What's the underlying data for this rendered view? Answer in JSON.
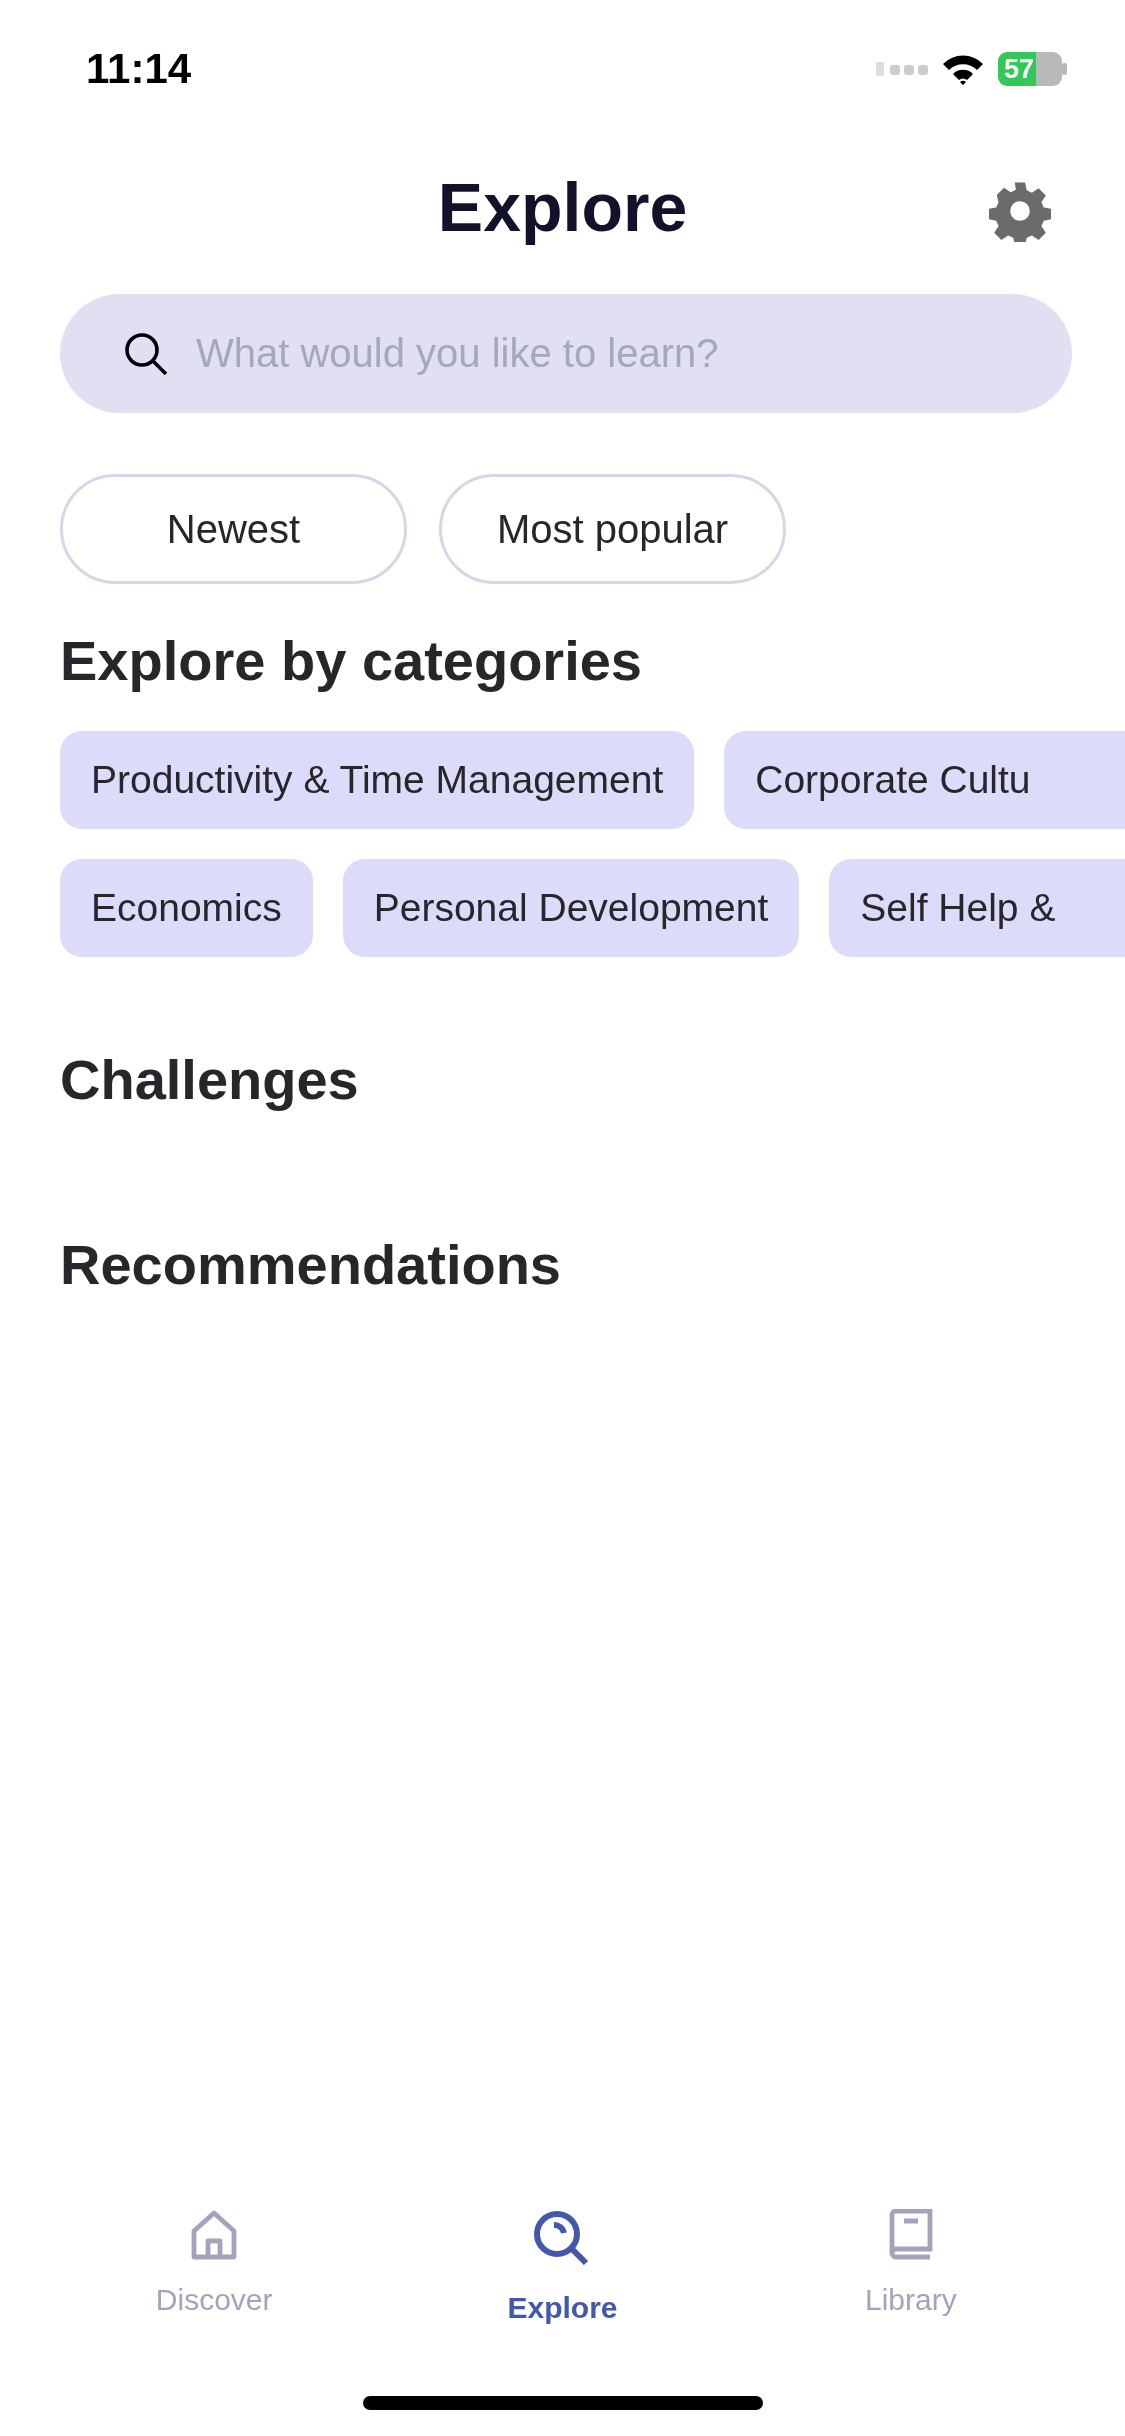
{
  "status_bar": {
    "time": "11:14",
    "battery": "57"
  },
  "header": {
    "title": "Explore"
  },
  "search": {
    "placeholder": "What would you like to learn?"
  },
  "filters": [
    {
      "label": "Newest"
    },
    {
      "label": "Most popular"
    }
  ],
  "categories": {
    "title": "Explore by categories",
    "lines": [
      {
        "chips": [
          "Productivity & Time Management",
          "Corporate Cultu"
        ]
      },
      {
        "chips": [
          "Economics",
          "Personal Development",
          "Self Help &"
        ]
      }
    ]
  },
  "sections": [
    {
      "title": "Challenges"
    },
    {
      "title": "Recommendations"
    }
  ],
  "tab_bar": [
    {
      "label": "Discover",
      "selected": false
    },
    {
      "label": "Explore",
      "selected": true
    },
    {
      "label": "Library",
      "selected": false
    }
  ]
}
